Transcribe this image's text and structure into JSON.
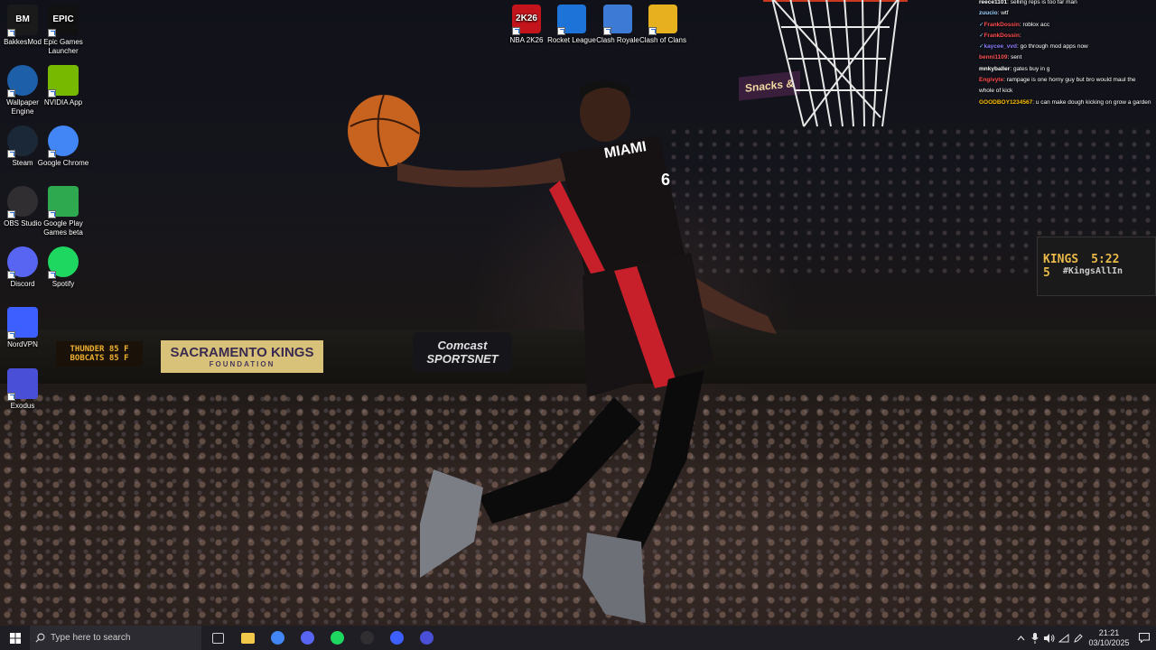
{
  "desktop": {
    "icons_left": [
      {
        "id": "bakkesmod",
        "label": "BakkesMod",
        "glyph": "BM",
        "color": "#1a1a1a"
      },
      {
        "id": "epic",
        "label": "Epic Games Launcher",
        "glyph": "EPIC",
        "color": "#111111"
      },
      {
        "id": "wallpaper-engine",
        "label": "Wallpaper Engine",
        "glyph": "",
        "color": "#1d5fa8"
      },
      {
        "id": "nvidia",
        "label": "NVIDIA App",
        "glyph": "",
        "color": "#76b900"
      },
      {
        "id": "steam",
        "label": "Steam",
        "glyph": "",
        "color": "#1b2838"
      },
      {
        "id": "chrome",
        "label": "Google Chrome",
        "glyph": "",
        "color": "#4285f4"
      },
      {
        "id": "obs",
        "label": "OBS Studio",
        "glyph": "",
        "color": "#302e31"
      },
      {
        "id": "google-play-games",
        "label": "Google Play Games beta",
        "glyph": "",
        "color": "#2ea94f"
      },
      {
        "id": "discord",
        "label": "Discord",
        "glyph": "",
        "color": "#5865f2"
      },
      {
        "id": "spotify",
        "label": "Spotify",
        "glyph": "",
        "color": "#1ed760"
      },
      {
        "id": "nordvpn",
        "label": "NordVPN",
        "glyph": "",
        "color": "#3e5fff"
      },
      {
        "id": "exodus",
        "label": "Exodus",
        "glyph": "",
        "color": "#4a4fd8"
      }
    ],
    "icons_top": [
      {
        "id": "nba2k26",
        "label": "NBA 2K26",
        "glyph": "2K26",
        "color": "#c3141b"
      },
      {
        "id": "rocket-league",
        "label": "Rocket League",
        "glyph": "",
        "color": "#1e73d8"
      },
      {
        "id": "clash-royale",
        "label": "Clash Royale",
        "glyph": "",
        "color": "#3d7ad6"
      },
      {
        "id": "clash-of-clans",
        "label": "Clash of Clans",
        "glyph": "",
        "color": "#e6b01e"
      }
    ],
    "wallpaper": {
      "banners": {
        "thunder": "THUNDER 85 F\nBOBCATS 85 F",
        "kings": "SACRAMENTO KINGS",
        "kings_sub": "FOUNDATION",
        "comcast": "Comcast SPORTSNET",
        "snacks": "Snacks &"
      },
      "scoreboard": {
        "team": "KINGS",
        "time": "5:22",
        "score": "5",
        "tag": "#KingsAllIn"
      },
      "jersey": {
        "text": "MIAMI",
        "number": "6"
      }
    }
  },
  "chat": [
    {
      "user": "reece1101",
      "user_color": "#ffffff",
      "msg": "selling reps is too far man",
      "prefix": ""
    },
    {
      "user": "zuucio",
      "user_color": "#9fd3ff",
      "msg": "wtf",
      "prefix": ""
    },
    {
      "user": "FrankDossin",
      "user_color": "#ff4d4d",
      "msg": "roblox acc",
      "prefix": "✓"
    },
    {
      "user": "FrankDossin",
      "user_color": "#ff4d4d",
      "msg": "",
      "prefix": "✓"
    },
    {
      "user": "kaycee_vvd",
      "user_color": "#8a7dff",
      "msg": "go through mod apps now",
      "prefix": "✓"
    },
    {
      "user": "benni1109",
      "user_color": "#ff5252",
      "msg": "sent",
      "prefix": ""
    },
    {
      "user": "mnkyballer",
      "user_color": "#ffffff",
      "msg": "gates buy in g",
      "prefix": ""
    },
    {
      "user": "Engivyte",
      "user_color": "#ff4d4d",
      "msg": "rampage is one horny guy but bro would maul the whole of kick",
      "prefix": ""
    },
    {
      "user": "GOODBOY1234567",
      "user_color": "#ffbf00",
      "msg": "u can make dough kicking on grow a garden",
      "prefix": ""
    }
  ],
  "taskbar": {
    "search_placeholder": "Type here to search",
    "pinned": [
      {
        "id": "task-view",
        "color": "#d0d0d0"
      },
      {
        "id": "file-explorer",
        "color": "#f2c84b"
      },
      {
        "id": "chrome",
        "color": "#4285f4"
      },
      {
        "id": "discord",
        "color": "#5865f2"
      },
      {
        "id": "spotify",
        "color": "#1ed760"
      },
      {
        "id": "obs",
        "color": "#302e31"
      },
      {
        "id": "nordvpn",
        "color": "#3e5fff"
      },
      {
        "id": "exodus",
        "color": "#4a4fd8"
      }
    ],
    "clock": {
      "time": "21:21",
      "date": "03/10/2025"
    }
  },
  "colors": {
    "taskbar": "#1f1e24",
    "accent": "#2a6ed8"
  }
}
